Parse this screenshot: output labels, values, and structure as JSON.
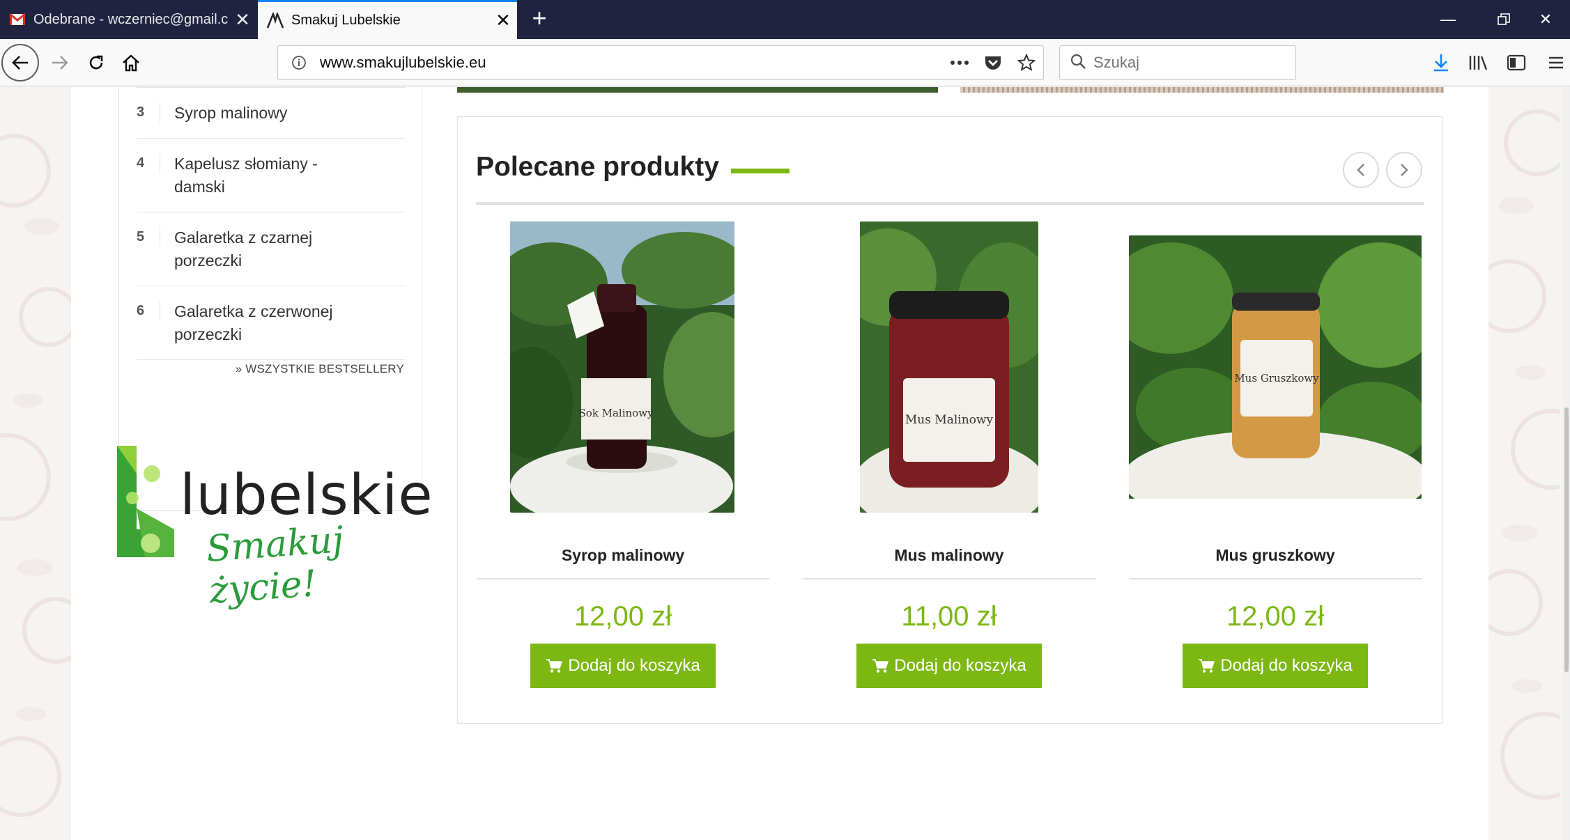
{
  "browser": {
    "tabs": [
      {
        "title": "Odebrane - wczerniec@gmail.c",
        "icon": "gmail-icon",
        "active": false
      },
      {
        "title": "Smakuj Lubelskie",
        "icon": "site-favicon",
        "active": true
      }
    ],
    "url": "www.smakujlubelskie.eu",
    "search_placeholder": "Szukaj"
  },
  "sidebar": {
    "bestsellers": [
      {
        "num": "3",
        "name": "Syrop malinowy"
      },
      {
        "num": "4",
        "name": "Kapelusz słomiany - damski"
      },
      {
        "num": "5",
        "name": "Galaretka z czarnej porzeczki"
      },
      {
        "num": "6",
        "name": "Galaretka z czerwonej porzeczki"
      }
    ],
    "all_link": "» WSZYSTKIE BESTSELLERY"
  },
  "logo": {
    "word": "lubelskie",
    "tagline": "Smakuj życie!"
  },
  "featured": {
    "title": "Polecane produkty",
    "products": [
      {
        "name": "Syrop malinowy",
        "price": "12,00 zł",
        "button": "Dodaj do koszyka",
        "label": "Sok Malinowy"
      },
      {
        "name": "Mus malinowy",
        "price": "11,00 zł",
        "button": "Dodaj do koszyka",
        "label": "Mus Malinowy"
      },
      {
        "name": "Mus gruszkowy",
        "price": "12,00 zł",
        "button": "Dodaj do koszyka",
        "label": "Mus Gruszkowy"
      }
    ]
  },
  "colors": {
    "accent": "#7db712",
    "tabbar": "#202340"
  }
}
